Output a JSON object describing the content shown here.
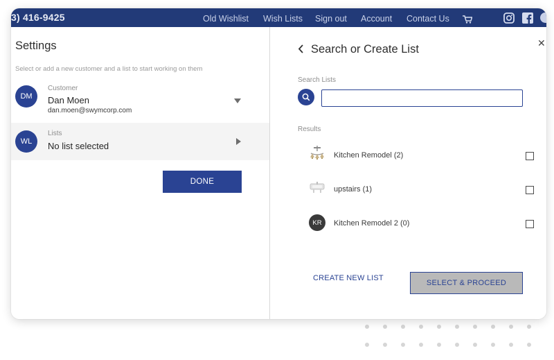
{
  "topbar": {
    "phone": "3) 416-9425",
    "links": [
      "Old Wishlist",
      "Wish Lists",
      "Sign out",
      "Account",
      "Contact Us"
    ],
    "icons": [
      "cart-icon",
      "instagram-icon",
      "facebook-icon"
    ]
  },
  "settings": {
    "title": "Settings",
    "hint": "Select or add a new customer and a list to start working on them",
    "customer": {
      "initials": "DM",
      "label": "Customer",
      "name": "Dan Moen",
      "email": "dan.moen@swymcorp.com"
    },
    "lists": {
      "initials": "WL",
      "label": "Lists",
      "value": "No list selected"
    },
    "done_label": "DONE"
  },
  "search_panel": {
    "title": "Search or Create List",
    "search_label": "Search Lists",
    "search_value": "",
    "results_label": "Results",
    "results": [
      {
        "label": "Kitchen Remodel (2)",
        "thumb": "chandelier-thumbnail"
      },
      {
        "label": "upstairs (1)",
        "thumb": "sink-thumbnail"
      },
      {
        "label": "Kitchen Remodel 2 (0)",
        "initials": "KR"
      }
    ],
    "create_label": "CREATE NEW LIST",
    "select_label": "SELECT & PROCEED"
  },
  "colors": {
    "brand": "#2a4393",
    "topbar": "#223a78",
    "button_disabled": "#b9b9b9"
  }
}
